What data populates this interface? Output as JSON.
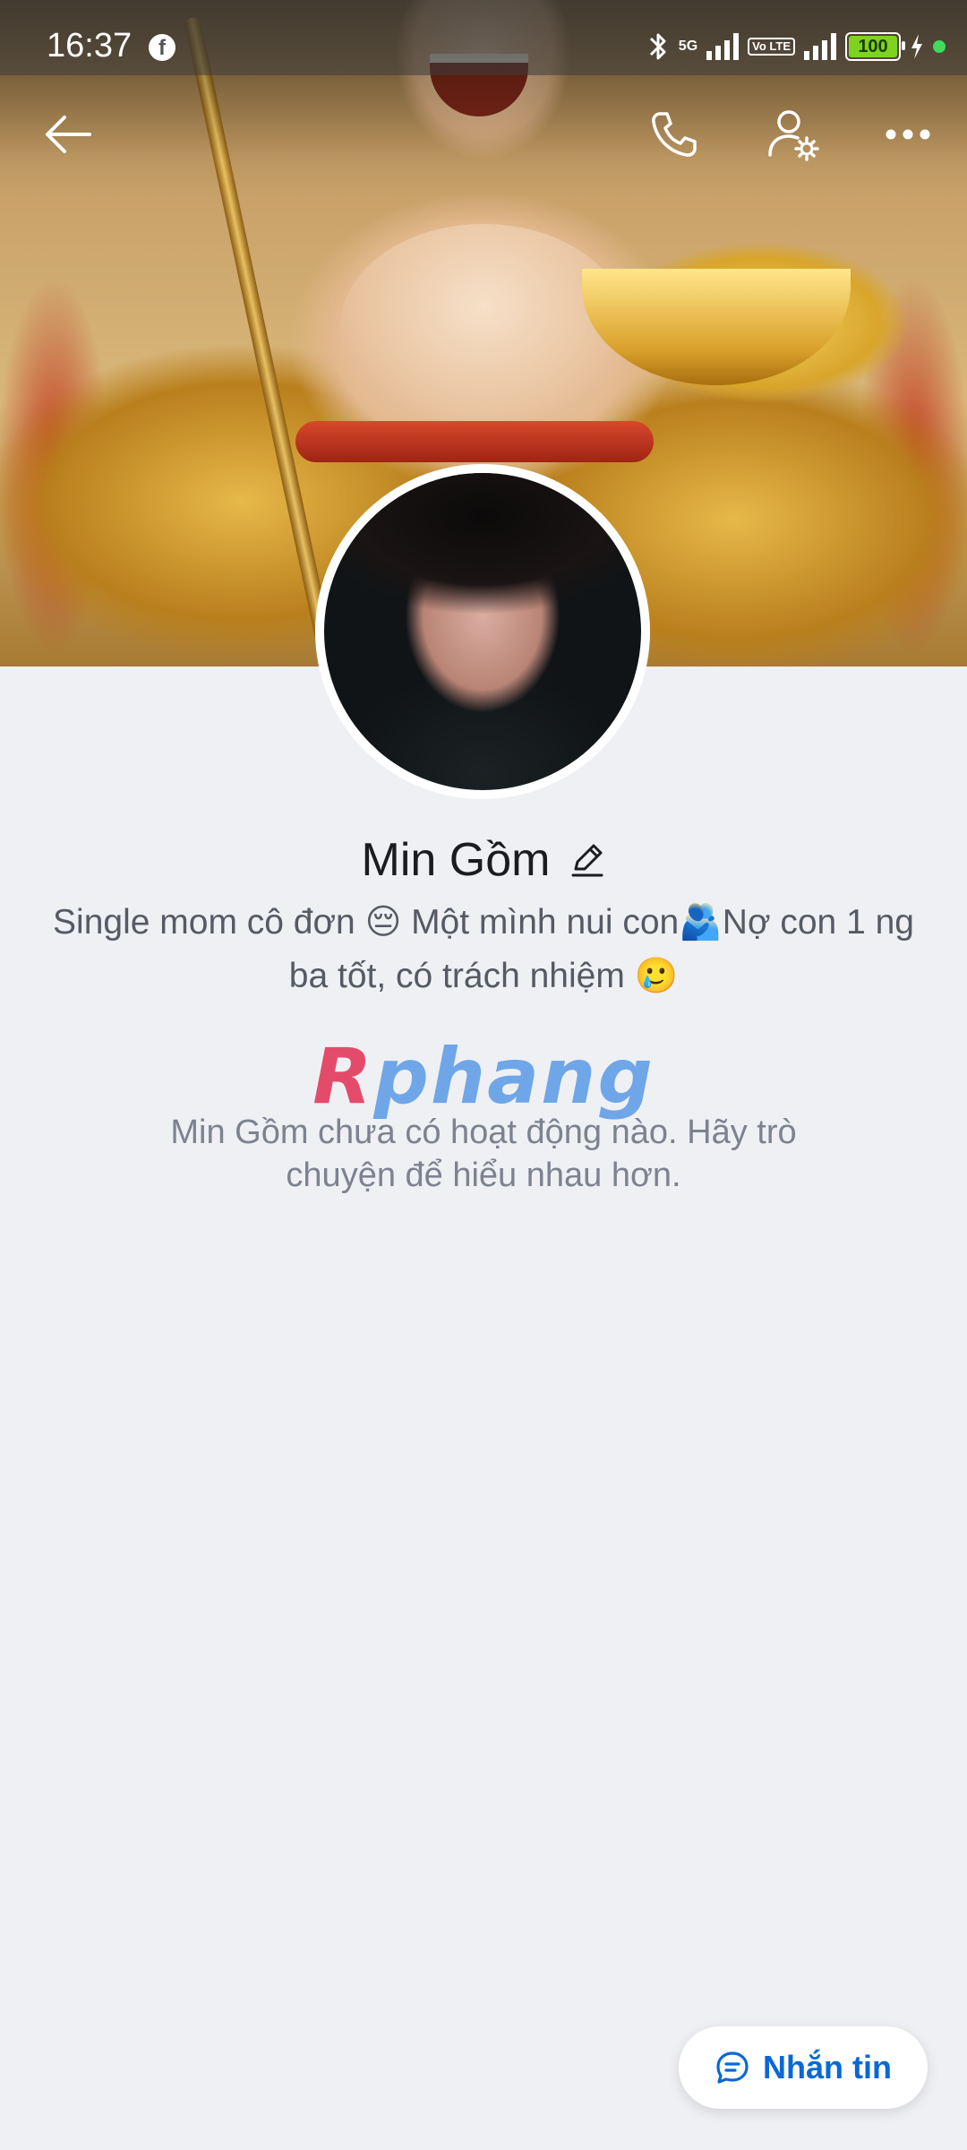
{
  "status_bar": {
    "time": "16:37",
    "network_5g": "5G",
    "volte": "Vo LTE",
    "battery": "100"
  },
  "header": {
    "icons": [
      "back-arrow-icon",
      "phone-icon",
      "user-settings-icon",
      "more-icon"
    ]
  },
  "profile": {
    "name": "Min Gồm",
    "bio": "Single mom cô đơn 😔 Một mình nui con🫂Nợ con 1 ng ba tốt, có trách nhiệm 🥲",
    "watermark": {
      "first": "R",
      "rest": "phang"
    },
    "empty_text": "Min Gồm chưa có hoạt động nào. Hãy trò chuyện để hiểu nhau hơn."
  },
  "actions": {
    "message_label": "Nhắn tin"
  },
  "colors": {
    "accent": "#0a68d4",
    "background": "#eff0f4"
  }
}
